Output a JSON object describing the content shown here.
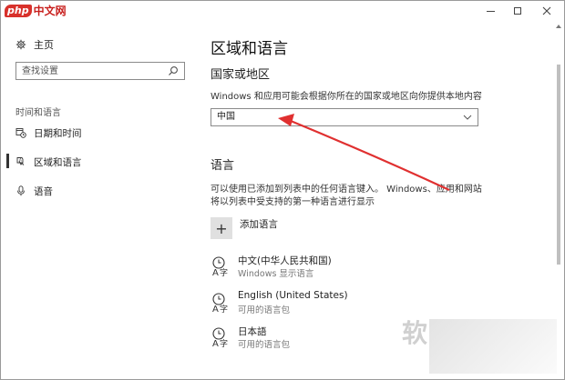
{
  "window": {
    "brand_badge": "php",
    "brand_text": "中文网",
    "controls": {
      "minimize": "—",
      "maximize": "☐",
      "close": "✕"
    }
  },
  "sidebar": {
    "home_label": "主页",
    "search_placeholder": "查找设置",
    "section_label": "时间和语言",
    "items": [
      {
        "label": "日期和时间",
        "icon": "calendar-clock-icon"
      },
      {
        "label": "区域和语言",
        "icon": "globe-keyboard-icon",
        "selected": true
      },
      {
        "label": "语音",
        "icon": "microphone-icon"
      }
    ]
  },
  "main": {
    "page_title": "区域和语言",
    "country": {
      "title": "国家或地区",
      "description": "Windows 和应用可能会根据你所在的国家或地区向你提供本地内容",
      "selected": "中国"
    },
    "language": {
      "title": "语言",
      "description_line1": "可以使用已添加到列表中的任何语言键入。 Windows、应用和网站",
      "description_line2": "将以列表中受支持的第一种语言进行显示",
      "add_label": "添加语言",
      "add_symbol": "+",
      "items": [
        {
          "name": "中文(中华人民共和国)",
          "sub": "Windows 显示语言"
        },
        {
          "name": "English (United States)",
          "sub": "可用的语言包"
        },
        {
          "name": "日本語",
          "sub": "可用的语言包"
        }
      ]
    }
  },
  "watermark": "软",
  "colors": {
    "annotation": "#e03030",
    "brand": "#d8312b"
  }
}
